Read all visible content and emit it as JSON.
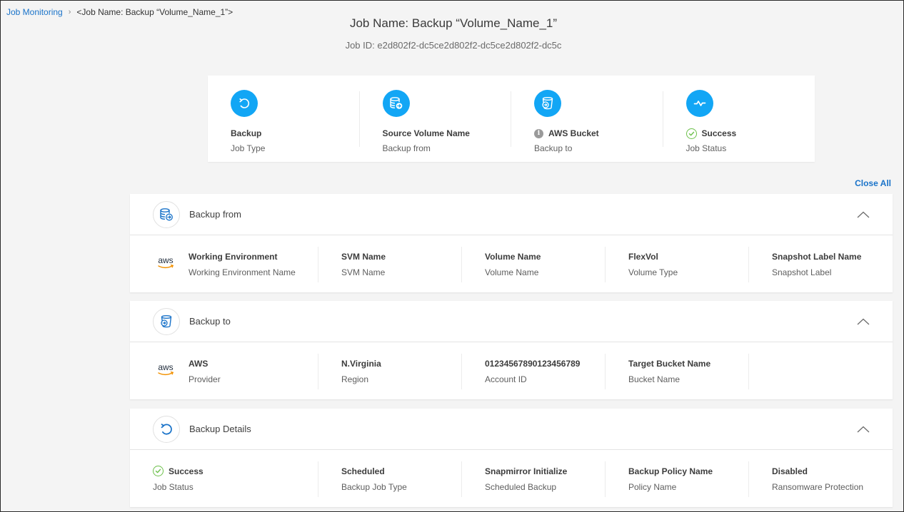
{
  "breadcrumb": {
    "root": "Job Monitoring",
    "separator": "›",
    "current": "<Job Name: Backup “Volume_Name_1”>"
  },
  "header": {
    "title": "Job Name: Backup “Volume_Name_1”",
    "job_id": "Job ID: e2d802f2-dc5ce2d802f2-dc5ce2d802f2-dc5c"
  },
  "summary": [
    {
      "icon": "backup-restore-icon",
      "value": "Backup",
      "label": "Job Type"
    },
    {
      "icon": "database-arrow-icon",
      "value": "Source Volume Name",
      "label": "Backup from"
    },
    {
      "icon": "bucket-arrow-icon",
      "value": "AWS Bucket",
      "label": "Backup to",
      "prefix_icon": "info-icon",
      "prefix_text": "i"
    },
    {
      "icon": "activity-pulse-icon",
      "value": "Success",
      "label": "Job Status",
      "prefix_icon": "check-circle-icon"
    }
  ],
  "close_all": "Close All",
  "colors": {
    "accent": "#12a6f5",
    "link": "#1a73c9",
    "success": "#6cc04a",
    "aws_orange": "#f29100"
  },
  "sections": [
    {
      "title": "Backup from",
      "icon": "database-arrow-icon",
      "fields": [
        {
          "value": "Working Environment",
          "label": "Working Environment Name",
          "logo": "aws"
        },
        {
          "value": "SVM Name",
          "label": "SVM Name"
        },
        {
          "value": "Volume Name",
          "label": "Volume Name"
        },
        {
          "value": "FlexVol",
          "label": "Volume Type"
        },
        {
          "value": "Snapshot Label Name",
          "label": "Snapshot Label"
        }
      ]
    },
    {
      "title": "Backup to",
      "icon": "bucket-arrow-icon",
      "fields": [
        {
          "value": "AWS",
          "label": "Provider",
          "logo": "aws"
        },
        {
          "value": "N.Virginia",
          "label": "Region"
        },
        {
          "value": "01234567890123456789",
          "label": "Account ID"
        },
        {
          "value": "Target Bucket Name",
          "label": "Bucket Name"
        },
        {
          "value": "",
          "label": ""
        }
      ]
    },
    {
      "title": "Backup Details",
      "icon": "backup-restore-icon",
      "fields": [
        {
          "value": "Success",
          "label": "Job Status",
          "prefix_icon": "check-circle-icon"
        },
        {
          "value": "Scheduled",
          "label": "Backup Job Type"
        },
        {
          "value": "Snapmirror Initialize",
          "label": "Scheduled Backup"
        },
        {
          "value": "Backup Policy Name",
          "label": "Policy Name"
        },
        {
          "value": "Disabled",
          "label": "Ransomware Protection"
        }
      ]
    }
  ],
  "aws_logo_text": "aws"
}
